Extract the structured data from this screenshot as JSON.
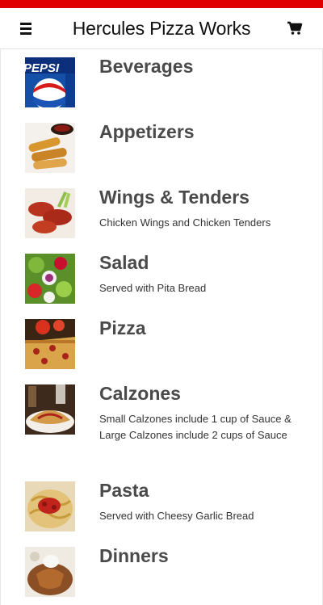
{
  "header": {
    "title": "Hercules Pizza Works",
    "menu_icon": "hamburger-menu-icon",
    "cart_icon": "shopping-cart-icon",
    "accent_color": "#e10000"
  },
  "categories": [
    {
      "name": "Beverages",
      "description": ""
    },
    {
      "name": "Appetizers",
      "description": ""
    },
    {
      "name": "Wings & Tenders",
      "description": "Chicken Wings and Chicken Tenders"
    },
    {
      "name": "Salad",
      "description": "Served with Pita Bread"
    },
    {
      "name": "Pizza",
      "description": ""
    },
    {
      "name": "Calzones",
      "description": "Small Calzones include 1 cup of Sauce &  Large Calzones include 2 cups of Sauce"
    },
    {
      "name": "Pasta",
      "description": "Served with Cheesy Garlic Bread"
    },
    {
      "name": "Dinners",
      "description": ""
    }
  ]
}
